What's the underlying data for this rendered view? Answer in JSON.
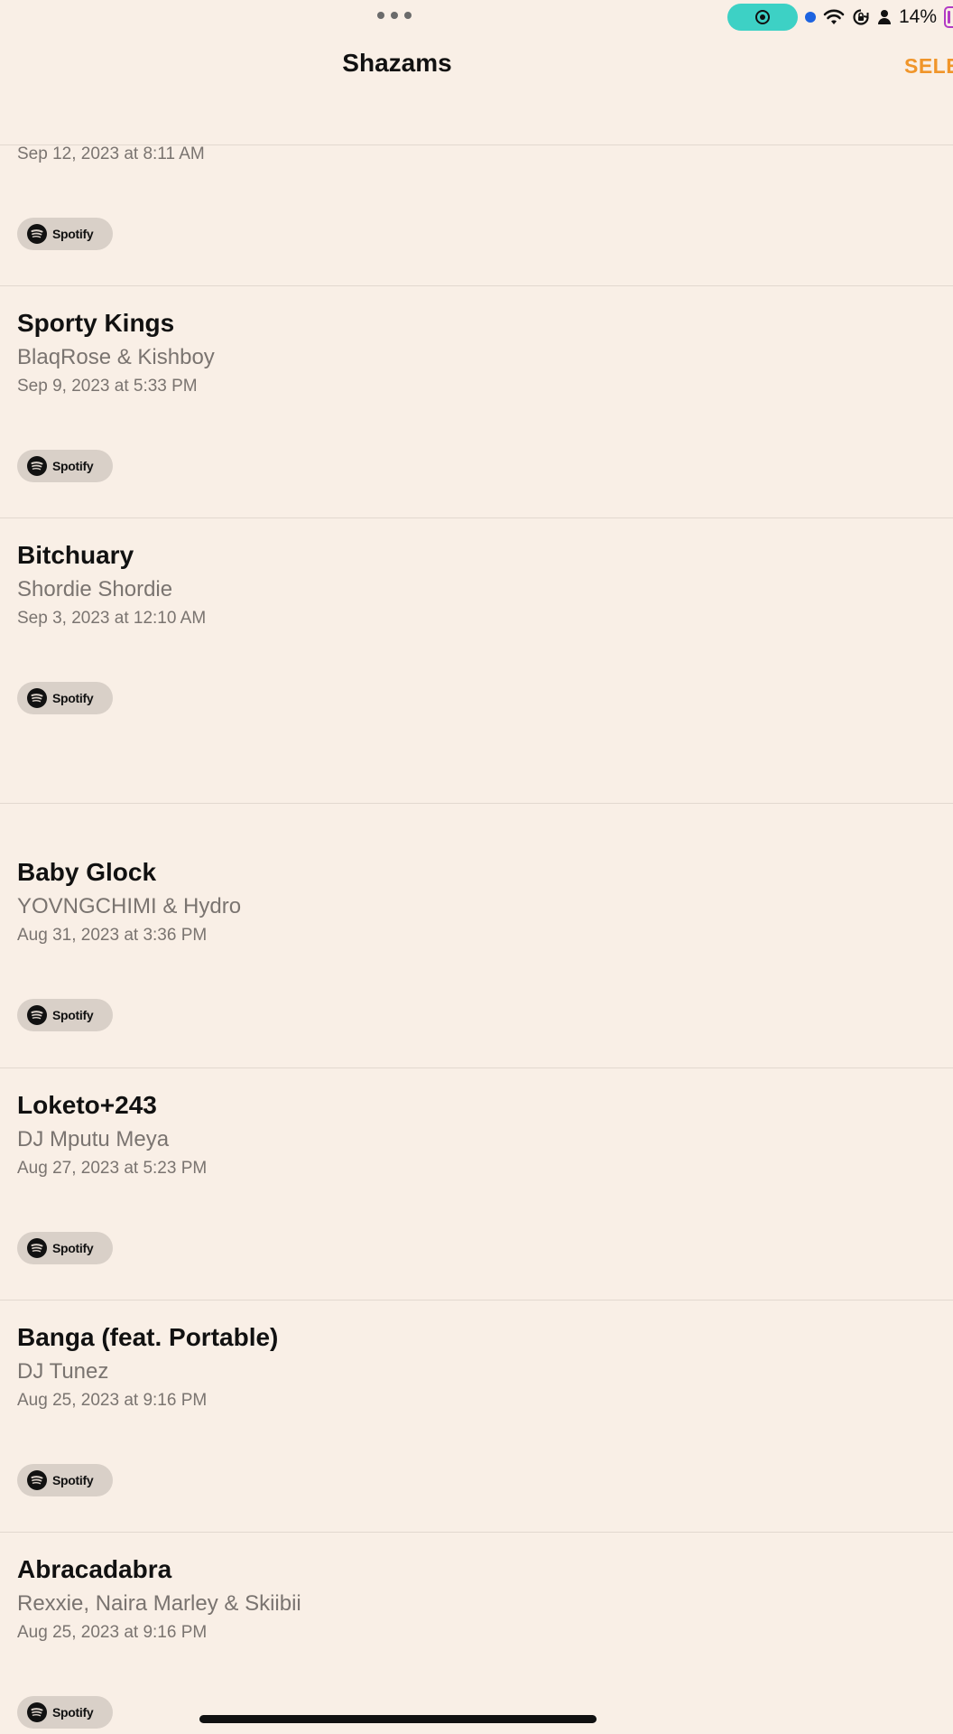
{
  "status_bar": {
    "battery_percent": "14%"
  },
  "nav": {
    "title": "Shazams",
    "select_label": "SELECT"
  },
  "spotify_label": "Spotify",
  "rows": [
    {
      "title": "",
      "artist": "",
      "date": "Sep 12, 2023 at 8:11 AM"
    },
    {
      "title": "Sporty Kings",
      "artist": "BlaqRose & Kishboy",
      "date": "Sep 9, 2023 at 5:33 PM"
    },
    {
      "title": "Bitchuary",
      "artist": "Shordie Shordie",
      "date": "Sep 3, 2023 at 12:10 AM"
    },
    {
      "title": "Baby Glock",
      "artist": "YOVNGCHIMI & Hydro",
      "date": "Aug 31, 2023 at 3:36 PM"
    },
    {
      "title": "Loketo+243",
      "artist": "DJ Mputu Meya",
      "date": "Aug 27, 2023 at 5:23 PM"
    },
    {
      "title": "Banga (feat. Portable)",
      "artist": "DJ Tunez",
      "date": "Aug 25, 2023 at 9:16 PM"
    },
    {
      "title": "Abracadabra",
      "artist": "Rexxie, Naira Marley & Skiibii",
      "date": "Aug 25, 2023 at 9:16 PM"
    }
  ],
  "colors": {
    "background": "#f9efe6",
    "accent": "#f0952a",
    "secondary_text": "#7a7470",
    "spotify_button_bg": "#d9d0c8"
  },
  "icons": {
    "status": [
      "more-dots-icon",
      "screen-record-icon",
      "location-dot-icon",
      "wifi-icon",
      "rotation-lock-icon",
      "person-icon",
      "battery-icon"
    ],
    "row_button": "spotify-icon"
  }
}
